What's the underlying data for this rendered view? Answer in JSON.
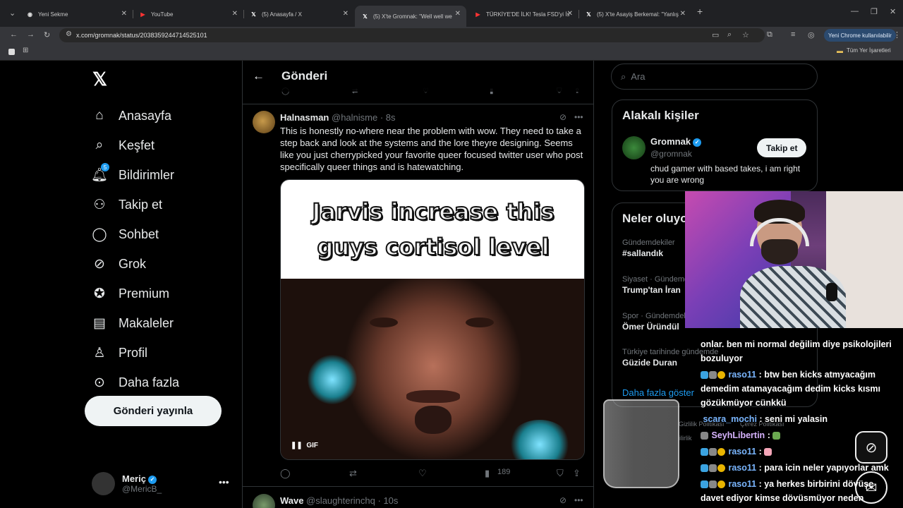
{
  "browser": {
    "tabs": [
      {
        "title": "Yeni Sekme",
        "icon": "chrome-icon"
      },
      {
        "title": "YouTube",
        "icon": "youtube-icon"
      },
      {
        "title": "(5) Anasayfa / X",
        "icon": "x-icon"
      },
      {
        "title": "(5) X'te Gromnak: \"Well well we",
        "icon": "x-icon"
      },
      {
        "title": "TÜRKİYE'DE İLK! Tesla FSD'yi İst",
        "icon": "youtube-icon"
      },
      {
        "title": "(5) X'te Asayiş Berkemal: \"Yanlış",
        "icon": "x-icon"
      }
    ],
    "url": "x.com/gromnak/status/2038359244714525101",
    "chrome_button": "Yeni Chrome kullanılabilir",
    "bookmarks_label": "Tüm Yer İşaretleri"
  },
  "nav": {
    "items": [
      {
        "label": "Anasayfa",
        "icon": "home-icon"
      },
      {
        "label": "Keşfet",
        "icon": "search-icon"
      },
      {
        "label": "Bildirimler",
        "icon": "bell-icon",
        "badge": "5"
      },
      {
        "label": "Takip et",
        "icon": "follow-icon"
      },
      {
        "label": "Sohbet",
        "icon": "chat-icon"
      },
      {
        "label": "Grok",
        "icon": "grok-icon"
      },
      {
        "label": "Premium",
        "icon": "premium-icon"
      },
      {
        "label": "Makaleler",
        "icon": "article-icon"
      },
      {
        "label": "Profil",
        "icon": "profile-icon"
      },
      {
        "label": "Daha fazla",
        "icon": "more-icon"
      }
    ],
    "post_button": "Gönderi yayınla",
    "account": {
      "name": "Meriç",
      "handle": "@MericB_"
    }
  },
  "main": {
    "title": "Gönderi",
    "tweet": {
      "author": "Halnasman",
      "handle": "@halnisme",
      "time": "· 8s",
      "text": "This is honestly no-where near the problem with wow. They need to take a step back and look at the systems and the lore theyre designing. Seems like you just cherrypicked your favorite queer focused twitter user who post specifically queer things and is hatewatching.",
      "media_caption_line1": "Jarvis increase this",
      "media_caption_line2": "guys cortisol level",
      "gif_label": "GIF",
      "views": "189"
    },
    "tweet2": {
      "author": "Wave",
      "handle": "@slaughterinchq",
      "time": "· 10s"
    }
  },
  "sidebar": {
    "search_placeholder": "Ara",
    "related_title": "Alakalı kişiler",
    "related": {
      "name": "Gromnak",
      "handle": "@gromnak",
      "bio": "chud gamer with based takes, i am right you are wrong",
      "follow_label": "Takip et"
    },
    "trends_title": "Neler oluyo",
    "trends": [
      {
        "context": "Gündemdekiler",
        "title": "#sallandık"
      },
      {
        "context": "Siyaset · Gündemde",
        "title": "Trump'tan İran"
      },
      {
        "context": "Spor · Gündemdek",
        "title": "Ömer Üründül"
      },
      {
        "context": "Türkiye tarihinde gündemde",
        "title": "Güzide Duran"
      }
    ],
    "show_more": "Daha fazla göster",
    "footer1": "Gizlilik Politikası",
    "footer2": "Çerez Politikası",
    "footer3": "ilirlik"
  },
  "chat": {
    "lines": [
      {
        "user": "",
        "text": "onlar. ben mi normal değilim diye psikolojileri"
      },
      {
        "user": "",
        "text": "bozuluyor"
      },
      {
        "user": "raso11",
        "text": ": btw ben kicks atmyacağım"
      },
      {
        "user": "",
        "text": "demedim atamayacağım dedim kicks kısmı"
      },
      {
        "user": "",
        "text": "gözükmüyor cünkkü"
      },
      {
        "user": "scara_mochi",
        "text": ": seni mi yalasin"
      },
      {
        "user": "SeyhLibertin",
        "text": ":"
      },
      {
        "user": "raso11",
        "text": ":"
      },
      {
        "user": "raso11",
        "text": ": para icin neler yapıyorlar amk"
      },
      {
        "user": "raso11",
        "text": ": ya herkes birbirini dövüşe"
      },
      {
        "user": "",
        "text": "davet ediyor kimse dövüsmüyor neden"
      }
    ]
  },
  "colors": {
    "accent": "#1d9bf0",
    "background": "#000000",
    "muted": "#71767b"
  }
}
